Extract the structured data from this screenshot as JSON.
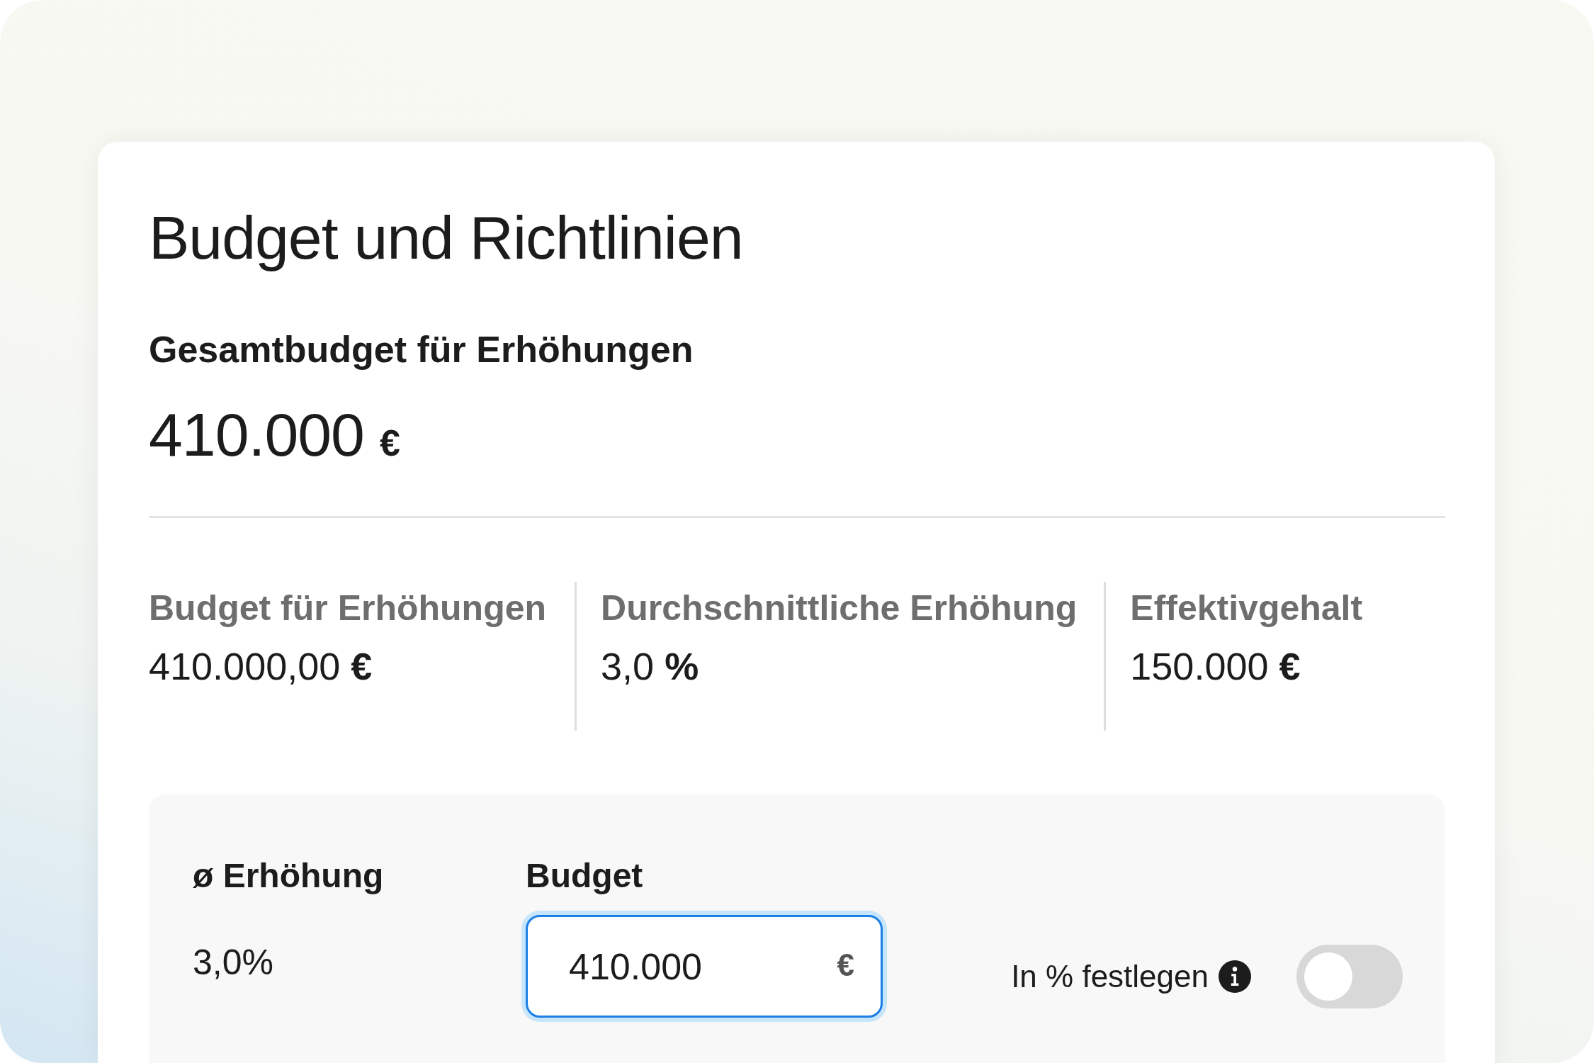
{
  "card": {
    "title": "Budget und Richtlinien",
    "total": {
      "label": "Gesamtbudget für Erhöhungen",
      "amount": "410.000",
      "currency": "€"
    },
    "stats": [
      {
        "label": "Budget für Erhöhungen",
        "value": "410.000,00 **€**"
      },
      {
        "label": "Durchschnittliche Erhöhung",
        "value": "3,0 **%**"
      },
      {
        "label": "Effektivgehalt",
        "value": "150.000 **€**"
      }
    ],
    "panel": {
      "average": {
        "label": "ø Erhöhung",
        "value": "3,0%"
      },
      "budget": {
        "label": "Budget",
        "value": "410.000",
        "suffix": "€",
        "focused": true
      },
      "percent_toggle": {
        "label": "In % festlegen",
        "on": false
      }
    }
  }
}
